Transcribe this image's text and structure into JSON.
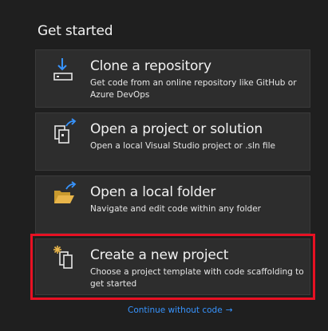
{
  "section_title": "Get started",
  "cards": [
    {
      "title": "Clone a repository",
      "description": "Get code from an online repository like GitHub or Azure DevOps",
      "icon": "clone-download-icon"
    },
    {
      "title": "Open a project or solution",
      "description": "Open a local Visual Studio project or .sln file",
      "icon": "open-project-icon"
    },
    {
      "title": "Open a local folder",
      "description": "Navigate and edit code within any folder",
      "icon": "folder-open-icon"
    },
    {
      "title": "Create a new project",
      "description": "Choose a project template with code scaffolding to get started",
      "icon": "new-project-icon",
      "highlighted": true
    }
  ],
  "continue_link": {
    "label": "Continue without code",
    "arrow": "→"
  },
  "colors": {
    "background": "#1f1f1f",
    "card_background": "#2d2d2d",
    "accent_blue": "#3794ff",
    "highlight_red": "#e81123"
  }
}
